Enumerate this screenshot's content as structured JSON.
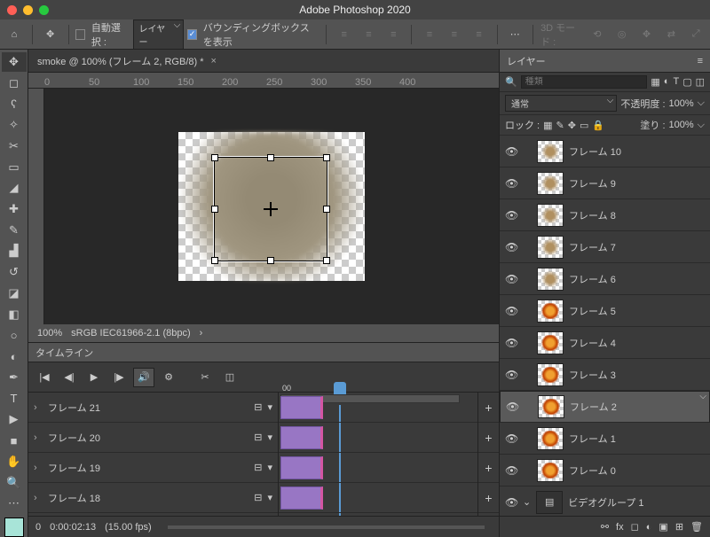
{
  "app_title": "Adobe Photoshop 2020",
  "options": {
    "auto_select_label": "自動選択 :",
    "auto_select_target": "レイヤー",
    "show_bbox_label": "バウンディングボックスを表示",
    "threeD_label": "3D モード :"
  },
  "document": {
    "tab_title": "smoke @ 100% (フレーム 2, RGB/8) *",
    "ruler_ticks": [
      "0",
      "50",
      "100",
      "150",
      "200",
      "250",
      "300",
      "350",
      "400"
    ],
    "zoom": "100%",
    "profile": "sRGB IEC61966-2.1 (8bpc)"
  },
  "timeline": {
    "panel_title": "タイムライン",
    "tick0": "00",
    "tracks": [
      "フレーム 21",
      "フレーム 20",
      "フレーム 19",
      "フレーム 18"
    ],
    "timecode": "0:00:02:13",
    "fps": "(15.00 fps)",
    "frame_num": "0"
  },
  "layers": {
    "panel_title": "レイヤー",
    "filter_placeholder": "種類",
    "blend_mode": "通常",
    "opacity_label": "不透明度 :",
    "opacity_value": "100%",
    "lock_label": "ロック :",
    "fill_label": "塗り :",
    "fill_value": "100%",
    "items": [
      {
        "name": "フレーム 10",
        "variant": "smoke"
      },
      {
        "name": "フレーム 9",
        "variant": "smoke"
      },
      {
        "name": "フレーム 8",
        "variant": "smoke"
      },
      {
        "name": "フレーム 7",
        "variant": "smoke"
      },
      {
        "name": "フレーム 6",
        "variant": "smoke"
      },
      {
        "name": "フレーム 5",
        "variant": "fire"
      },
      {
        "name": "フレーム 4",
        "variant": "fire"
      },
      {
        "name": "フレーム 3",
        "variant": "fire"
      },
      {
        "name": "フレーム 2",
        "variant": "fire",
        "selected": true
      },
      {
        "name": "フレーム 1",
        "variant": "fire"
      },
      {
        "name": "フレーム 0",
        "variant": "fire"
      }
    ],
    "video_group": "ビデオグループ 1"
  }
}
